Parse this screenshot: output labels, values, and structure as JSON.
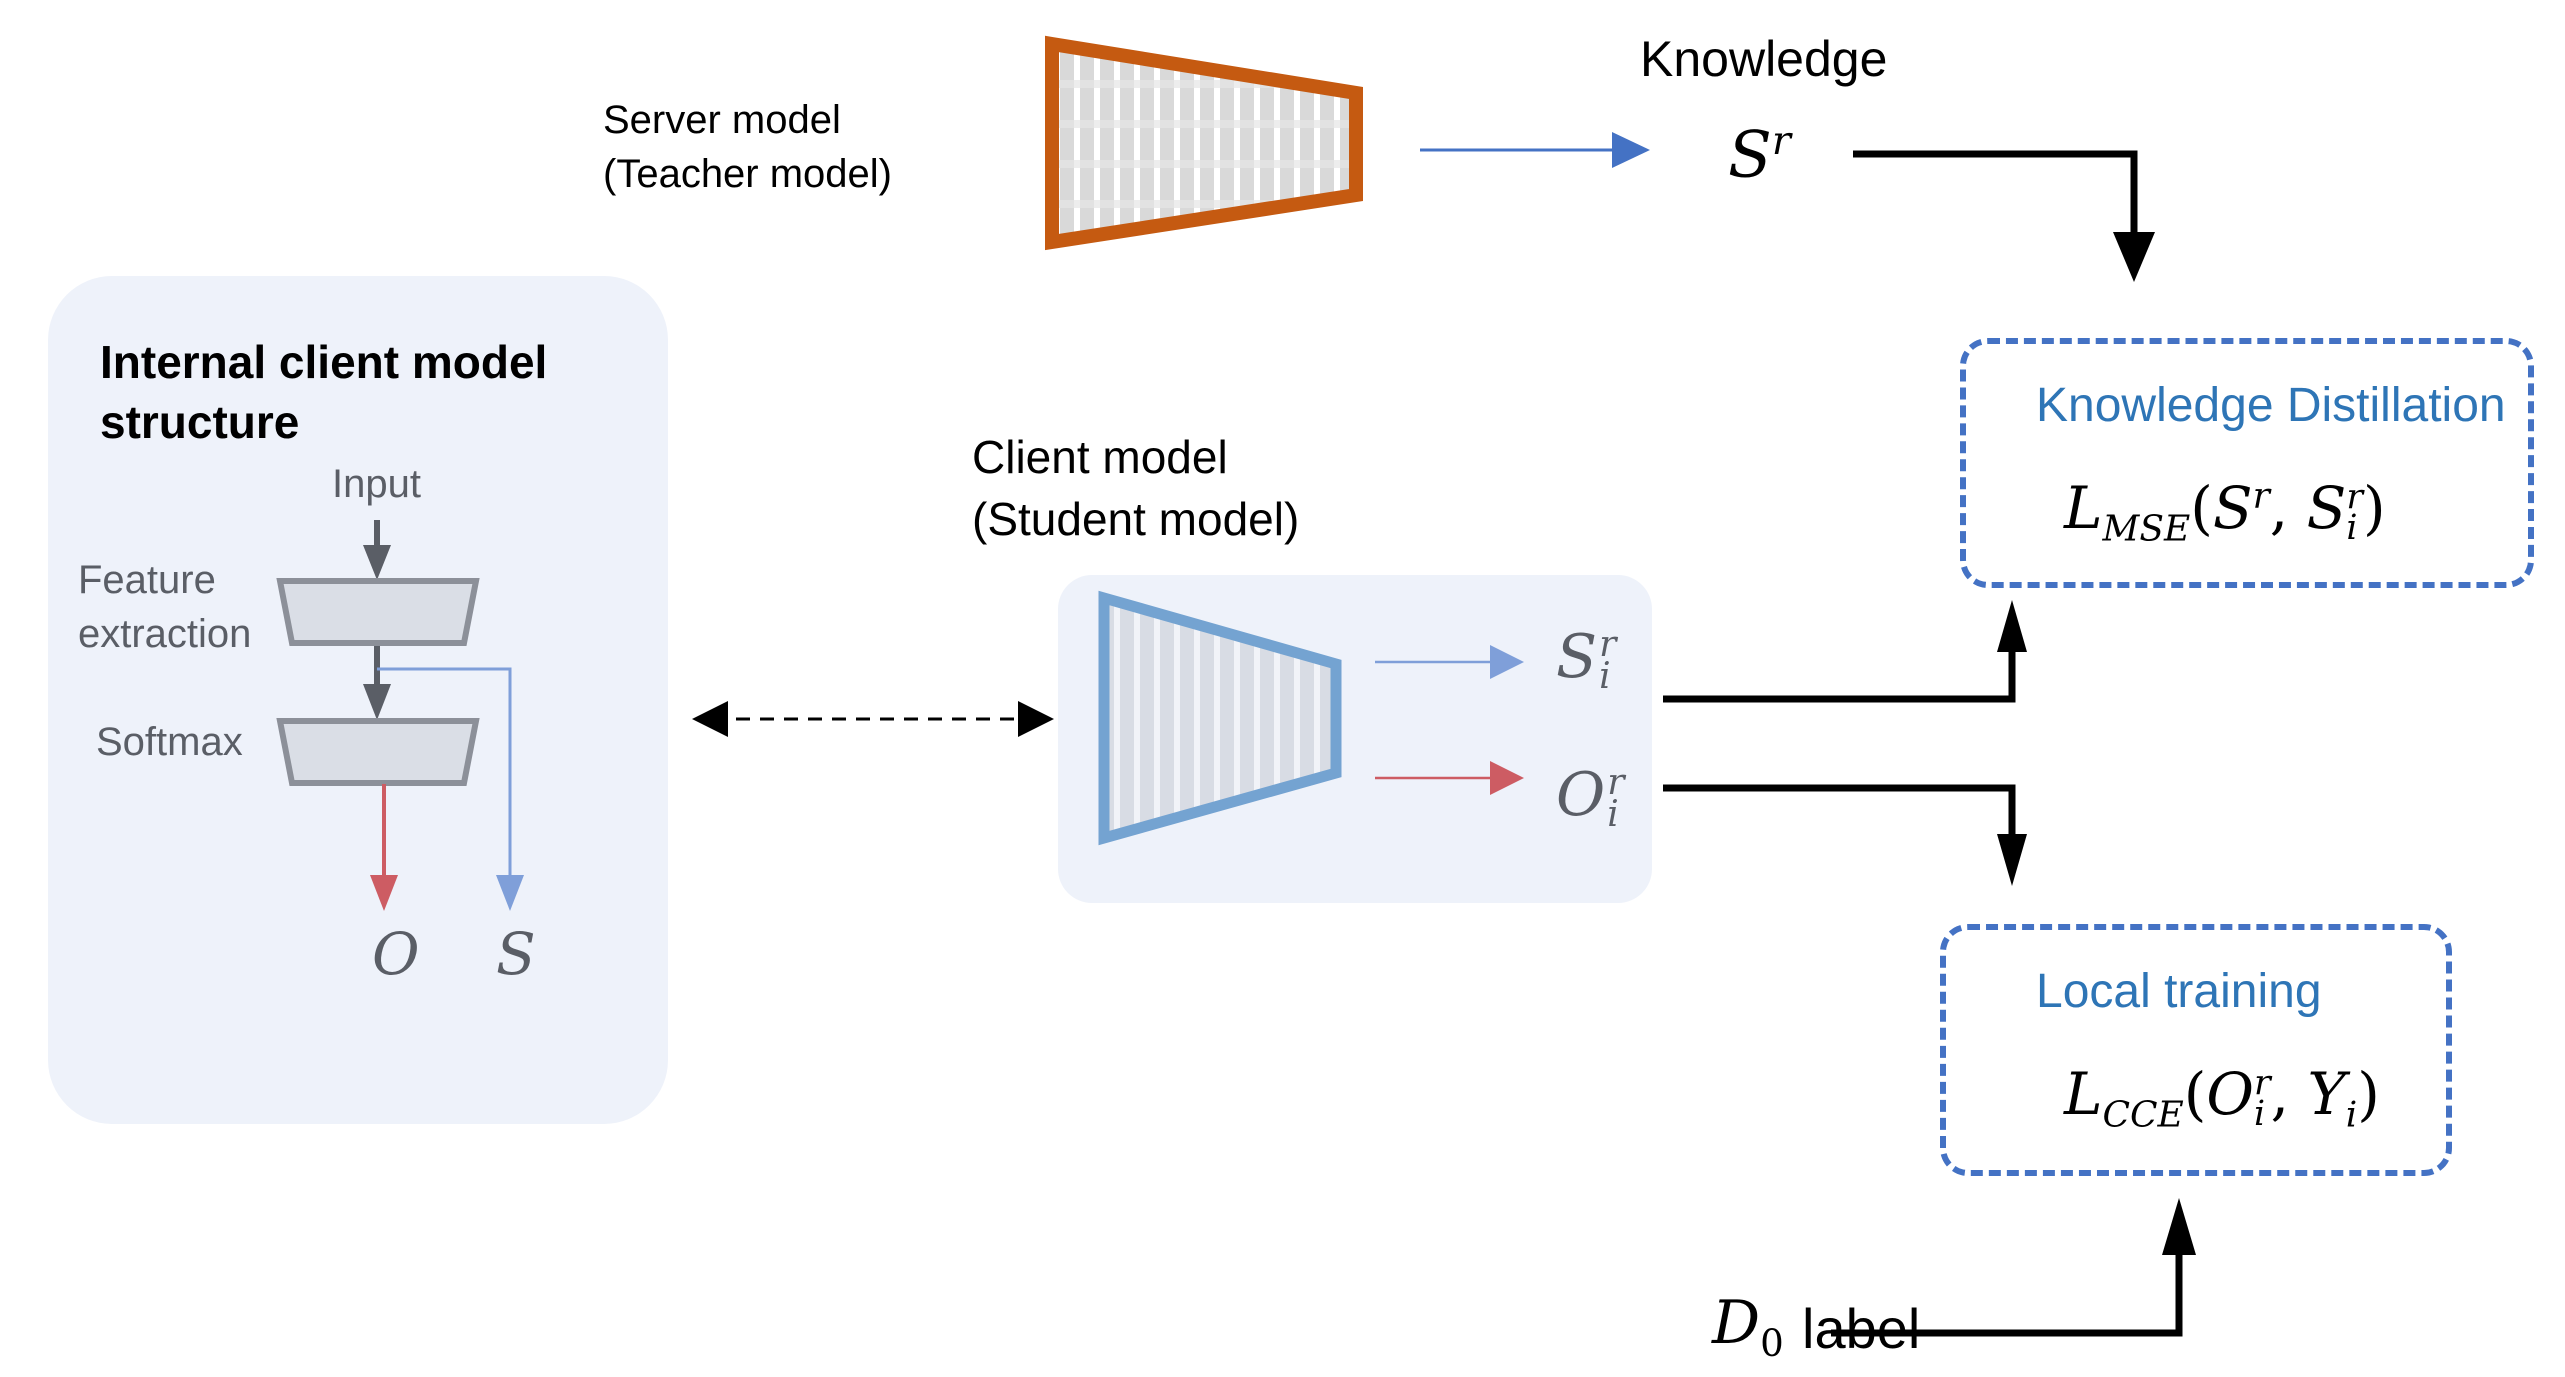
{
  "server": {
    "label_line1": "Server model",
    "label_line2": "(Teacher model)",
    "color": "#c55a11"
  },
  "knowledge": {
    "label": "Knowledge",
    "symbol": "S",
    "symbol_sup": "r"
  },
  "internal": {
    "title_line1": "Internal client model",
    "title_line2": "structure",
    "input_label": "Input",
    "feature_label_line1": "Feature",
    "feature_label_line2": "extraction",
    "softmax_label": "Softmax",
    "output_o": "O",
    "output_s": "S"
  },
  "client": {
    "label_line1": "Client model",
    "label_line2": "(Student model)",
    "out_s": "S",
    "out_s_sup": "r",
    "out_s_sub": "i",
    "out_o": "O",
    "out_o_sup": "r",
    "out_o_sub": "i",
    "color": "#74a3d1"
  },
  "kd_box": {
    "title": "Knowledge Distillation",
    "formula_L": "L",
    "formula_sub": "MSE",
    "formula_rest_open": "(S",
    "formula_sup1": "r",
    "formula_mid": ", S",
    "formula_sup2": "r",
    "formula_sub2": "i",
    "formula_close": ")"
  },
  "local_box": {
    "title": "Local training",
    "formula_L": "L",
    "formula_sub": "CCE",
    "formula_open": "(O",
    "formula_sup": "r",
    "formula_sub2": "i",
    "formula_mid": ", Y",
    "formula_sub3": "i",
    "formula_close": ")"
  },
  "d0": {
    "symbol": "D",
    "sub": "0",
    "label": "label"
  },
  "colors": {
    "accent_blue": "#4472c4",
    "title_blue": "#2e75b6",
    "red_arrow": "#cd5c63",
    "light_blue_arrow": "#7f9fd9",
    "panel_bg": "#eef2fa"
  }
}
